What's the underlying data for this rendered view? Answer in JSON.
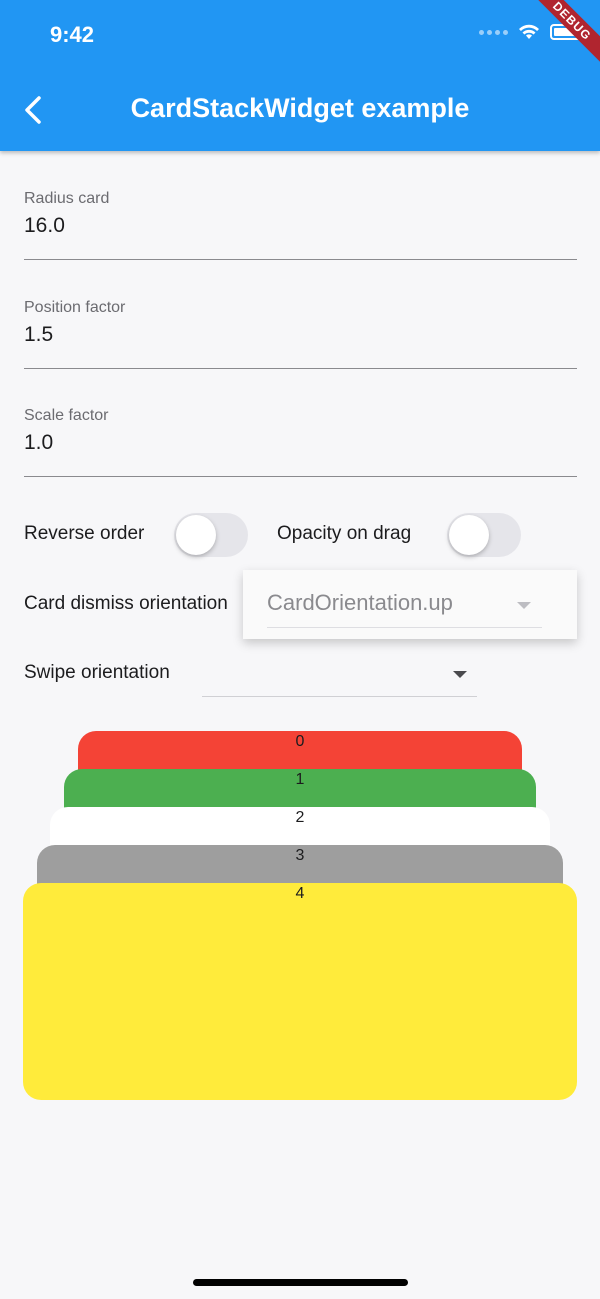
{
  "status_bar": {
    "time": "9:42"
  },
  "debug_banner": "DEBUG",
  "app_bar": {
    "title": "CardStackWidget example"
  },
  "form": {
    "radius": {
      "label": "Radius card",
      "value": "16.0"
    },
    "position": {
      "label": "Position factor",
      "value": "1.5"
    },
    "scale": {
      "label": "Scale factor",
      "value": "1.0"
    },
    "reverse_order": {
      "label": "Reverse order",
      "on": false
    },
    "opacity_on_drag": {
      "label": "Opacity on drag",
      "on": false
    },
    "card_dismiss": {
      "label": "Card dismiss orientation",
      "selected": "CardOrientation.up"
    },
    "swipe": {
      "label": "Swipe orientation",
      "selected": ""
    }
  },
  "cards": [
    {
      "label": "0",
      "color": "#f44336"
    },
    {
      "label": "1",
      "color": "#4caf50"
    },
    {
      "label": "2",
      "color": "#ffffff"
    },
    {
      "label": "3",
      "color": "#9e9e9e"
    },
    {
      "label": "4",
      "color": "#ffeb3b"
    }
  ],
  "colors": {
    "app_bar": "#2196f3",
    "background": "#f7f7f9"
  }
}
